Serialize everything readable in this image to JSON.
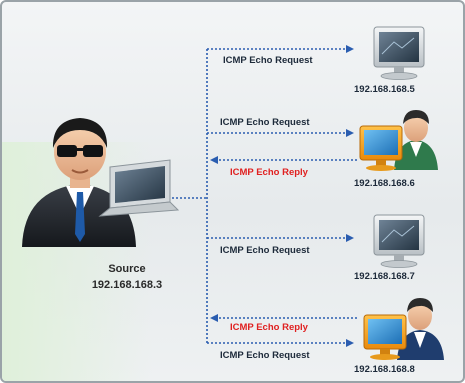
{
  "source": {
    "label": "Source",
    "ip": "192.168.168.3"
  },
  "targets": [
    {
      "ip": "192.168.168.5",
      "request": "ICMP Echo Request"
    },
    {
      "ip": "192.168.168.6",
      "request": "ICMP Echo Request",
      "reply": "ICMP Echo Reply"
    },
    {
      "ip": "192.168.168.7",
      "request": "ICMP Echo Request"
    },
    {
      "ip": "192.168.168.8",
      "request": "ICMP Echo Request",
      "reply": "ICMP Echo Reply"
    }
  ],
  "colors": {
    "arrow": "#2a5db0",
    "request_text": "#1d2a3a",
    "reply_text": "#e02020"
  },
  "icons": {
    "source": "hacker-with-laptop-icon",
    "idle_host": "monitor-icon",
    "user_host": "user-with-monitor-icon"
  }
}
